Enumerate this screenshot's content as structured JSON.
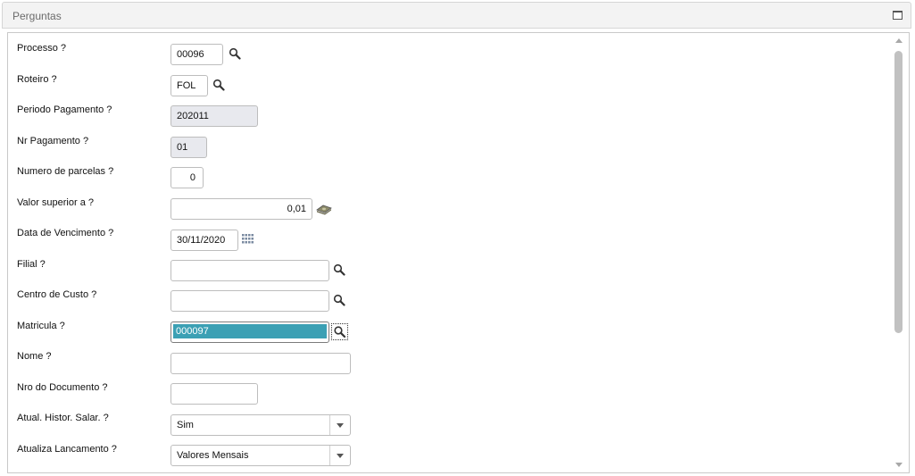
{
  "panel": {
    "title": "Perguntas"
  },
  "fields": {
    "processo": {
      "label": "Processo ?",
      "value": "00096"
    },
    "roteiro": {
      "label": "Roteiro ?",
      "value": "FOL"
    },
    "periodo_pagamento": {
      "label": "Periodo Pagamento ?",
      "value": "202011"
    },
    "nr_pagamento": {
      "label": "Nr Pagamento ?",
      "value": "01"
    },
    "numero_parcelas": {
      "label": "Numero de parcelas ?",
      "value": "0"
    },
    "valor_superior": {
      "label": "Valor superior a ?",
      "value": "0,01"
    },
    "data_vencimento": {
      "label": "Data de Vencimento ?",
      "value": "30/11/2020"
    },
    "filial": {
      "label": "Filial ?",
      "value": ""
    },
    "centro_custo": {
      "label": "Centro de Custo ?",
      "value": ""
    },
    "matricula": {
      "label": "Matricula ?",
      "value": "000097"
    },
    "nome": {
      "label": "Nome ?",
      "value": ""
    },
    "nro_documento": {
      "label": "Nro do Documento ?",
      "value": ""
    },
    "atual_histor_salar": {
      "label": "Atual. Histor. Salar. ?",
      "value": "Sim"
    },
    "atualiza_lancamento": {
      "label": "Atualiza Lancamento ?",
      "value": "Valores Mensais"
    }
  },
  "icons": {
    "search": "search-icon",
    "money": "money-icon",
    "calendar": "calendar-icon",
    "collapse": "collapse-icon"
  },
  "colors": {
    "selection": "#3ba0b4",
    "readonly_bg": "#e8e9ee",
    "header_bg": "#f3f3f3"
  }
}
